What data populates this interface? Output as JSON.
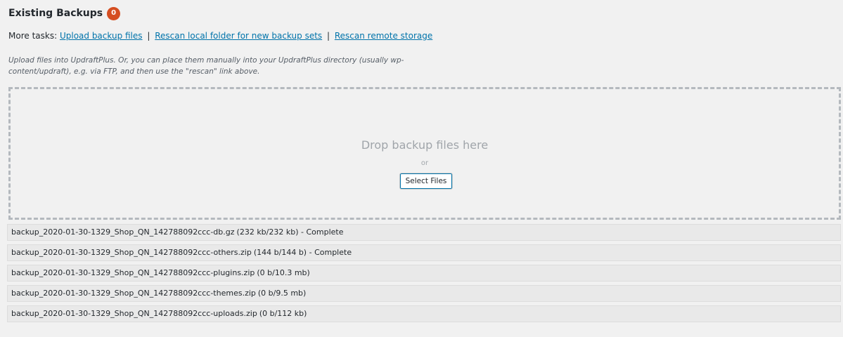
{
  "header": {
    "title": "Existing Backups",
    "count": "0"
  },
  "tasks": {
    "prefix": "More tasks:",
    "links": [
      "Upload backup files",
      "Rescan local folder for new backup sets",
      "Rescan remote storage"
    ]
  },
  "help_text": "Upload files into UpdraftPlus. Or, you can place them manually into your UpdraftPlus directory (usually wp-content/updraft), e.g. via FTP, and then use the \"rescan\" link above.",
  "dropzone": {
    "title": "Drop backup files here",
    "or": "or",
    "button": "Select Files"
  },
  "files": [
    {
      "name": "backup_2020-01-30-1329_Shop_QN_142788092ccc-db.gz",
      "size": "(232 kb/232 kb)",
      "status": " - Complete"
    },
    {
      "name": "backup_2020-01-30-1329_Shop_QN_142788092ccc-others.zip",
      "size": "(144 b/144 b)",
      "status": " - Complete"
    },
    {
      "name": "backup_2020-01-30-1329_Shop_QN_142788092ccc-plugins.zip",
      "size": "(0 b/10.3 mb)",
      "status": ""
    },
    {
      "name": "backup_2020-01-30-1329_Shop_QN_142788092ccc-themes.zip",
      "size": "(0 b/9.5 mb)",
      "status": ""
    },
    {
      "name": "backup_2020-01-30-1329_Shop_QN_142788092ccc-uploads.zip",
      "size": "(0 b/112 kb)",
      "status": ""
    }
  ],
  "colors": {
    "badge": "#d54e21",
    "link": "#0073aa"
  }
}
